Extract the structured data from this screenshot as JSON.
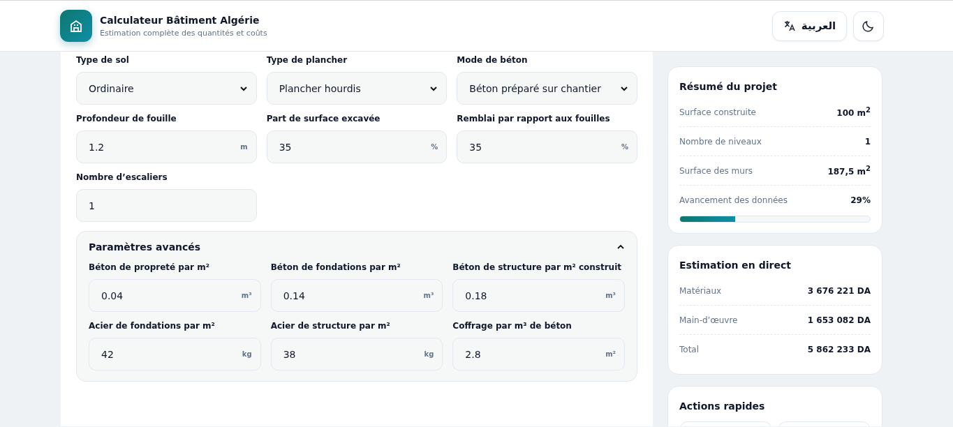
{
  "header": {
    "title": "Calculateur Bâtiment Algérie",
    "subtitle": "Estimation complète des quantités et coûts",
    "language_button": "العربية"
  },
  "fields": [
    {
      "kind": "select",
      "label": "Type de sol",
      "value": "Ordinaire"
    },
    {
      "kind": "select",
      "label": "Type de plancher",
      "value": "Plancher hourdis"
    },
    {
      "kind": "select",
      "label": "Mode de béton",
      "value": "Béton préparé sur chantier"
    },
    {
      "kind": "input",
      "label": "Profondeur de fouille",
      "value": "1.2",
      "unit": "m"
    },
    {
      "kind": "input",
      "label": "Part de surface excavée",
      "value": "35",
      "unit": "%"
    },
    {
      "kind": "input",
      "label": "Remblai par rapport aux fouilles",
      "value": "35",
      "unit": "%"
    },
    {
      "kind": "input",
      "label": "Nombre d’escaliers",
      "value": "1"
    }
  ],
  "advanced": {
    "title": "Paramètres avancés",
    "expanded": true,
    "fields": [
      {
        "label": "Béton de propreté par m²",
        "value": "0.04",
        "unit": "m³"
      },
      {
        "label": "Béton de fondations par m²",
        "value": "0.14",
        "unit": "m³"
      },
      {
        "label": "Béton de structure par m² construit",
        "value": "0.18",
        "unit": "m³"
      },
      {
        "label": "Acier de fondations par m²",
        "value": "42",
        "unit": "kg"
      },
      {
        "label": "Acier de structure par m²",
        "value": "38",
        "unit": "kg"
      },
      {
        "label": "Coffrage par m³ de béton",
        "value": "2.8",
        "unit": "m²"
      }
    ]
  },
  "summary": {
    "title": "Résumé du projet",
    "rows": [
      {
        "label": "Surface construite",
        "value": "100 m$^{2}$"
      },
      {
        "label": "Nombre de niveaux",
        "value": "1"
      },
      {
        "label": "Surface des murs",
        "value": "187,5 m$^{2}$"
      },
      {
        "label": "Avancement des données",
        "value": "29%"
      }
    ],
    "progress": {
      "level": 0.29
    }
  },
  "estimate": {
    "title": "Estimation en direct",
    "rows": [
      {
        "label": "Matériaux",
        "value": "3 676 221 DA"
      },
      {
        "label": "Main-d’œuvre",
        "value": "1 653 082 DA"
      },
      {
        "label": "Total",
        "value": "5 862 233 DA"
      }
    ]
  },
  "quick_actions": {
    "title": "Actions rapides"
  }
}
